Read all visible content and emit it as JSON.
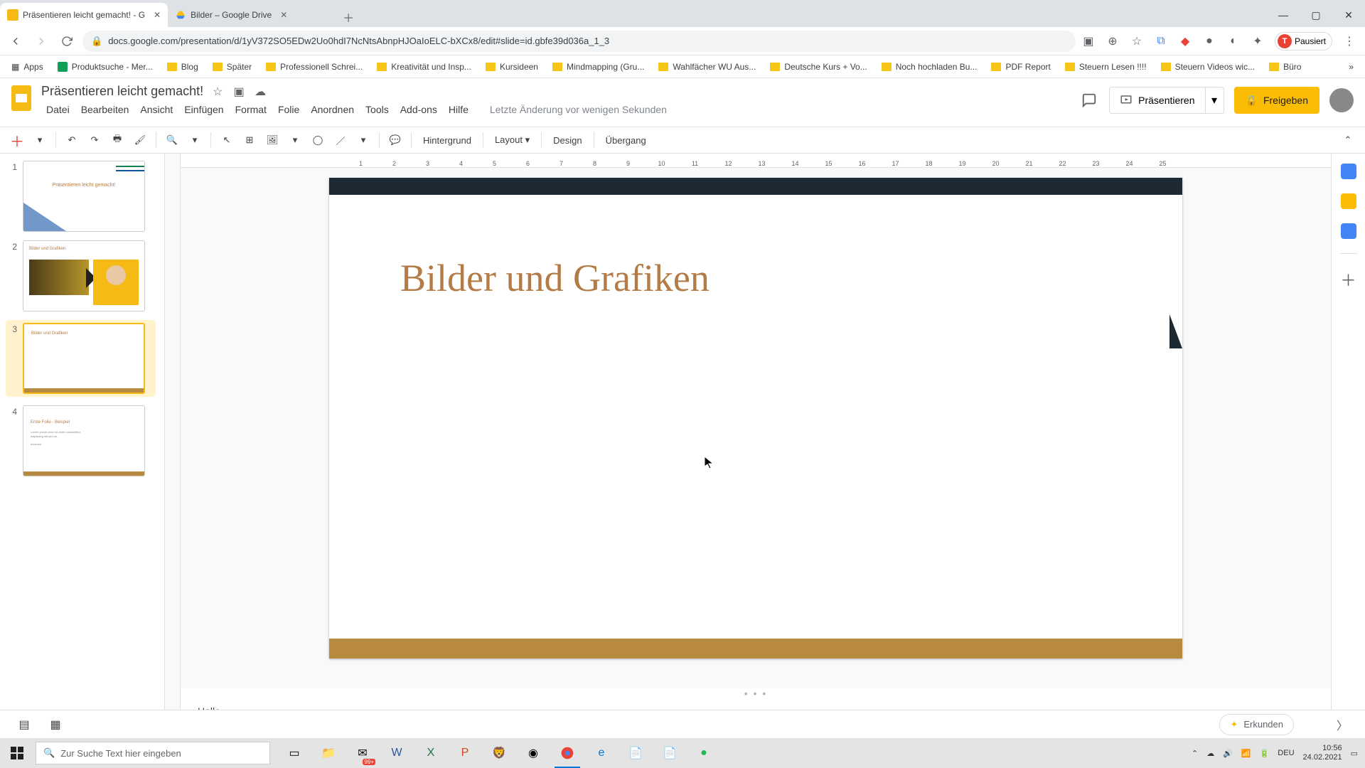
{
  "browser": {
    "tabs": [
      {
        "title": "Präsentieren leicht gemacht! - G",
        "favicon": "slides"
      },
      {
        "title": "Bilder – Google Drive",
        "favicon": "drive"
      }
    ],
    "url": "docs.google.com/presentation/d/1yV372SO5EDw2Uo0hdI7NcNtsAbnpHJOaIoELC-bXCx8/edit#slide=id.gbfe39d036a_1_3",
    "profile_label": "Pausiert",
    "profile_initial": "T"
  },
  "bookmarks": {
    "apps": "Apps",
    "items": [
      "Produktsuche - Mer...",
      "Blog",
      "Später",
      "Professionell Schrei...",
      "Kreativität und Insp...",
      "Kursideen",
      "Mindmapping  (Gru...",
      "Wahlfächer WU Aus...",
      "Deutsche Kurs + Vo...",
      "Noch hochladen Bu...",
      "PDF Report",
      "Steuern Lesen !!!!",
      "Steuern Videos wic...",
      "Büro"
    ]
  },
  "app": {
    "doc_title": "Präsentieren leicht gemacht!",
    "last_edit": "Letzte Änderung vor wenigen Sekunden",
    "menu": [
      "Datei",
      "Bearbeiten",
      "Ansicht",
      "Einfügen",
      "Format",
      "Folie",
      "Anordnen",
      "Tools",
      "Add-ons",
      "Hilfe"
    ],
    "present": "Präsentieren",
    "share": "Freigeben"
  },
  "toolbar": {
    "hintergrund": "Hintergrund",
    "layout": "Layout",
    "design": "Design",
    "uebergang": "Übergang"
  },
  "ruler": [
    "1",
    "2",
    "3",
    "4",
    "5",
    "6",
    "7",
    "8",
    "9",
    "10",
    "11",
    "12",
    "13",
    "14",
    "15",
    "16",
    "17",
    "18",
    "19",
    "20",
    "21",
    "22",
    "23",
    "24",
    "25"
  ],
  "slides": [
    {
      "num": "1",
      "title": "Präsentieren leicht gemacht!"
    },
    {
      "num": "2",
      "title": "Bilder und Grafiken"
    },
    {
      "num": "3",
      "title": "Bilder und Grafiken"
    },
    {
      "num": "4",
      "title": "Erste Folie - Beispiel"
    }
  ],
  "current_slide": {
    "heading": "Bilder und Grafiken"
  },
  "notes": {
    "text": "Hallo"
  },
  "explore": {
    "label": "Erkunden"
  },
  "taskbar": {
    "search_placeholder": "Zur Suche Text hier eingeben",
    "lang": "DEU",
    "time": "10:56",
    "date": "24.02.2021",
    "badge": "99+"
  }
}
